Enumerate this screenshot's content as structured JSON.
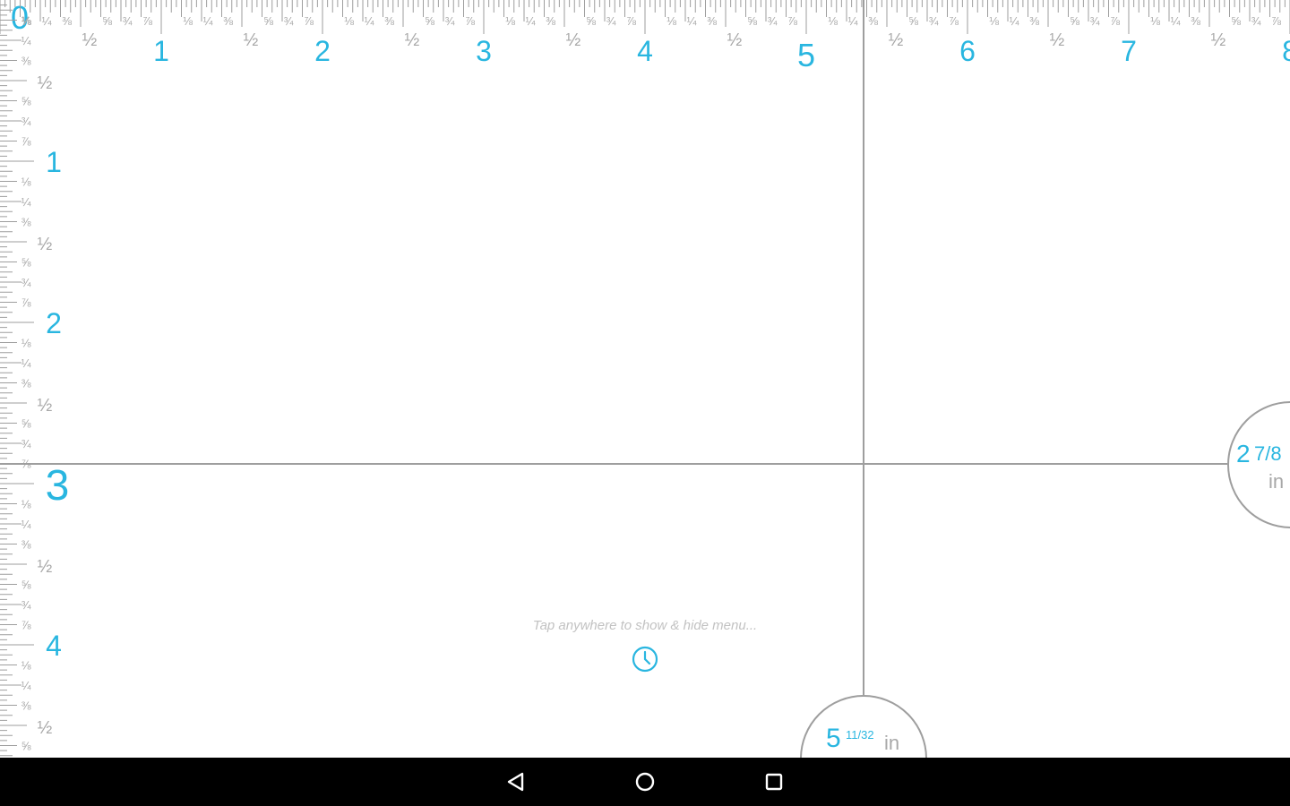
{
  "ruler": {
    "unit": "in",
    "accent_color": "#29b6e0",
    "tick_color": "#9e9e9e",
    "fraction_label_color": "#a8a8a8",
    "top_scale": {
      "whole_labels": [
        "0",
        "1",
        "2",
        "3",
        "4",
        "5",
        "6",
        "7",
        "8"
      ],
      "fraction_labels": [
        "⅛",
        "¼",
        "⅜",
        "½",
        "⅝",
        "¾",
        "⅞"
      ]
    },
    "left_scale": {
      "whole_labels": [
        "1",
        "2",
        "3",
        "4"
      ],
      "fraction_labels": [
        "⅛",
        "¼",
        "⅜",
        "½",
        "⅝",
        "¾",
        "⅞"
      ]
    }
  },
  "readouts": {
    "horizontal": {
      "whole": "5",
      "fraction": "11/32",
      "unit": "in"
    },
    "vertical": {
      "whole": "2",
      "fraction": "7/8",
      "unit": "in"
    }
  },
  "hint": {
    "text": "Tap anywhere to show & hide menu...",
    "history_icon": "clock-icon"
  },
  "navbar": {
    "back_icon": "back-triangle-icon",
    "home_icon": "home-circle-icon",
    "recents_icon": "recents-square-icon"
  }
}
